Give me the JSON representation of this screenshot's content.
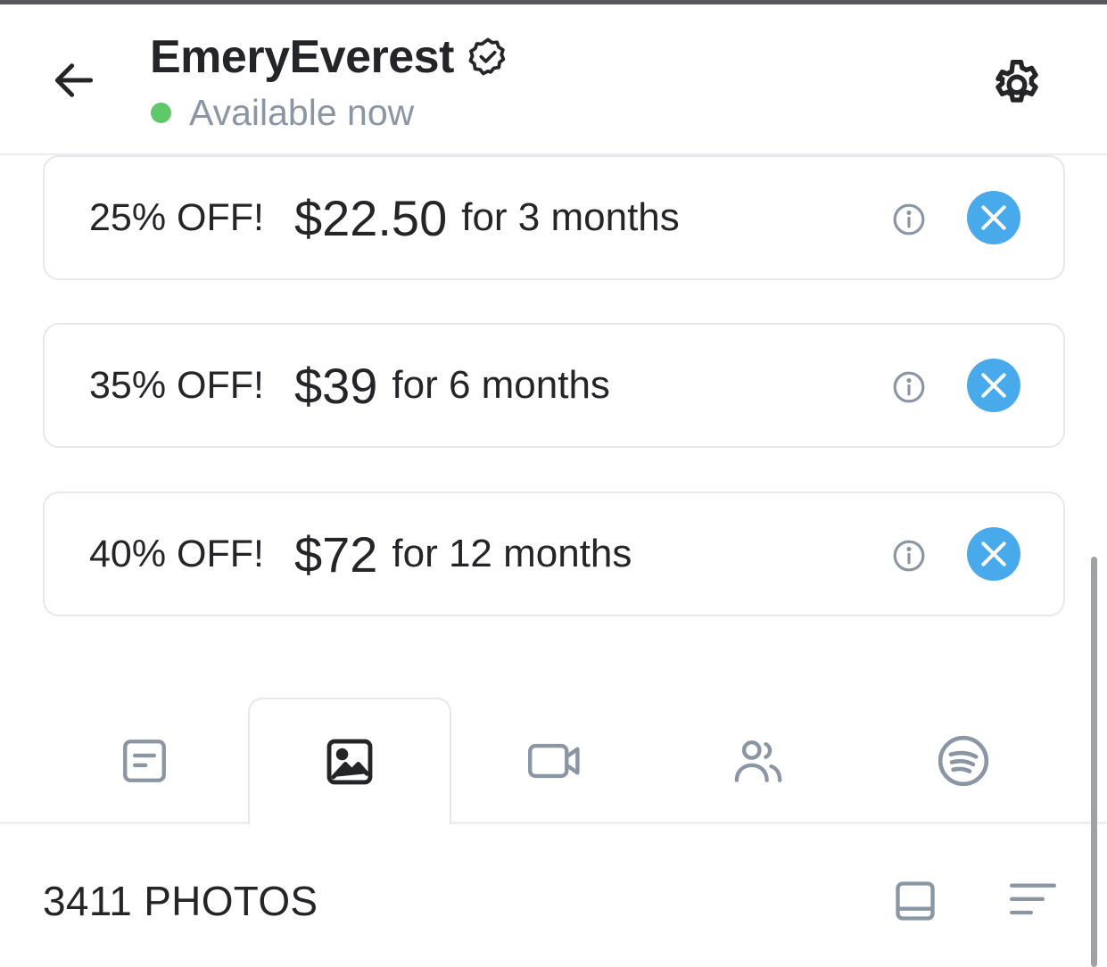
{
  "header": {
    "username": "EmeryEverest",
    "status_text": "Available now",
    "icons": {
      "back": "arrow-left-icon",
      "verified": "verified-badge-icon",
      "settings": "gear-icon"
    },
    "colors": {
      "status_dot": "#5fc96a",
      "status_text": "#8a96a3"
    }
  },
  "offers": [
    {
      "discount": "25% OFF!",
      "price": "$22.50",
      "period": "for 3 months"
    },
    {
      "discount": "35% OFF!",
      "price": "$39",
      "period": "for 6 months"
    },
    {
      "discount": "40% OFF!",
      "price": "$72",
      "period": "for 12 months"
    }
  ],
  "offer_icons": {
    "info": "info-icon",
    "remove": "close-icon"
  },
  "tabs": [
    {
      "name": "posts",
      "icon": "post-icon",
      "active": false
    },
    {
      "name": "photos",
      "icon": "image-icon",
      "active": true
    },
    {
      "name": "videos",
      "icon": "video-icon",
      "active": false
    },
    {
      "name": "friends",
      "icon": "people-icon",
      "active": false
    },
    {
      "name": "spotify",
      "icon": "spotify-icon",
      "active": false
    }
  ],
  "media": {
    "count_label": "3411 PHOTOS"
  },
  "colors": {
    "accent": "#48aaeb",
    "icon_grey": "#8a96a3",
    "text": "#242529"
  }
}
